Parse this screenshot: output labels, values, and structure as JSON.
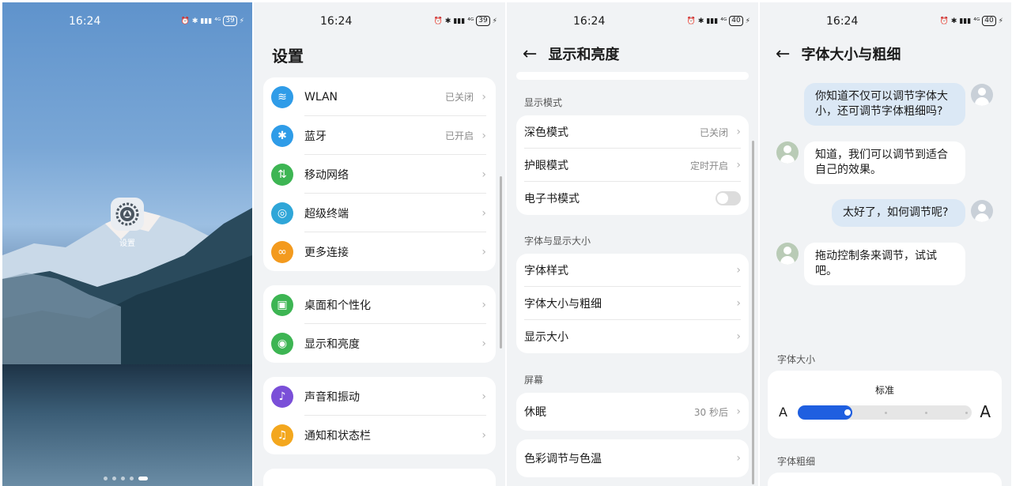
{
  "screens": {
    "home": {
      "time": "16:24",
      "status_signal": "⁴ᴳ",
      "battery": "39",
      "app_label": "设置",
      "icon": "settings-gear-icon",
      "page_count": 5,
      "active_page": 5
    },
    "settings": {
      "time": "16:24",
      "status_signal": "⁴ᴳ",
      "battery": "39",
      "title": "设置",
      "groups": [
        [
          {
            "label": "WLAN",
            "value": "已关闭",
            "icon": "wifi-icon",
            "color": "#2f9ce8"
          },
          {
            "label": "蓝牙",
            "value": "已开启",
            "icon": "bluetooth-icon",
            "color": "#2f9ce8"
          },
          {
            "label": "移动网络",
            "value": "",
            "icon": "mobile-network-icon",
            "color": "#3db553"
          },
          {
            "label": "超级终端",
            "value": "",
            "icon": "super-device-icon",
            "color": "#2fa6d8"
          },
          {
            "label": "更多连接",
            "value": "",
            "icon": "link-icon",
            "color": "#f39a1e"
          }
        ],
        [
          {
            "label": "桌面和个性化",
            "value": "",
            "icon": "wallpaper-icon",
            "color": "#3db553"
          },
          {
            "label": "显示和亮度",
            "value": "",
            "icon": "eye-icon",
            "color": "#3db553"
          }
        ],
        [
          {
            "label": "声音和振动",
            "value": "",
            "icon": "sound-icon",
            "color": "#7a4fd8"
          },
          {
            "label": "通知和状态栏",
            "value": "",
            "icon": "bell-icon",
            "color": "#f3a71e"
          }
        ]
      ]
    },
    "display": {
      "time": "16:24",
      "status_signal": "⁴ᴳ",
      "battery": "40",
      "title": "显示和亮度",
      "sections": [
        {
          "header": "显示模式",
          "rows": [
            {
              "label": "深色模式",
              "value": "已关闭",
              "type": "link"
            },
            {
              "label": "护眼模式",
              "value": "定时开启",
              "type": "link"
            },
            {
              "label": "电子书模式",
              "value": "",
              "type": "toggle",
              "on": false
            }
          ]
        },
        {
          "header": "字体与显示大小",
          "rows": [
            {
              "label": "字体样式",
              "value": "",
              "type": "link"
            },
            {
              "label": "字体大小与粗细",
              "value": "",
              "type": "link"
            },
            {
              "label": "显示大小",
              "value": "",
              "type": "link"
            }
          ]
        },
        {
          "header": "屏幕",
          "rows": [
            {
              "label": "休眠",
              "value": "30 秒后",
              "type": "link"
            }
          ]
        },
        {
          "header": "",
          "rows": [
            {
              "label": "色彩调节与色温",
              "value": "",
              "type": "link"
            }
          ]
        }
      ]
    },
    "font": {
      "time": "16:24",
      "status_signal": "⁴ᴳ",
      "battery": "40",
      "title": "字体大小与粗细",
      "messages": [
        {
          "from": "me",
          "text": "你知道不仅可以调节字体大小，还可调节字体粗细吗?"
        },
        {
          "from": "other",
          "text": "知道，我们可以调节到适合自己的效果。"
        },
        {
          "from": "me",
          "text": "太好了，如何调节呢?"
        },
        {
          "from": "other",
          "text": "拖动控制条来调节，试试吧。"
        }
      ],
      "size_header": "字体大小",
      "size_value": "标准",
      "size_small_glyph": "A",
      "size_large_glyph": "A",
      "size_level": 2,
      "size_levels": 5,
      "weight_header": "字体粗细"
    }
  },
  "colors": {
    "accent": "#1f5fe0",
    "background": "#f1f3f5",
    "bubble_me": "#dbe8f5"
  }
}
